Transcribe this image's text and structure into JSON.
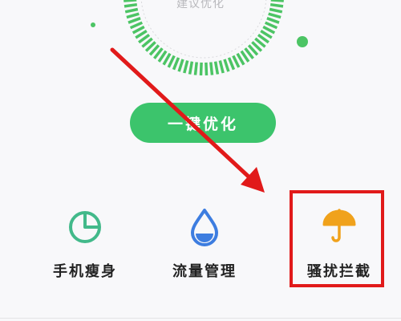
{
  "gauge": {
    "caption": "建议优化",
    "accent_color": "#4cc464"
  },
  "optimize_button": {
    "label": "一键优化",
    "color": "#3cc46c"
  },
  "tools": [
    {
      "label": "手机瘦身",
      "icon": "pie-chart-icon",
      "color": "#42b98a"
    },
    {
      "label": "流量管理",
      "icon": "water-drop-icon",
      "color": "#3d7de0"
    },
    {
      "label": "骚扰拦截",
      "icon": "umbrella-icon",
      "color": "#f0a21c"
    }
  ],
  "annotation": {
    "color": "#e11a1a"
  }
}
